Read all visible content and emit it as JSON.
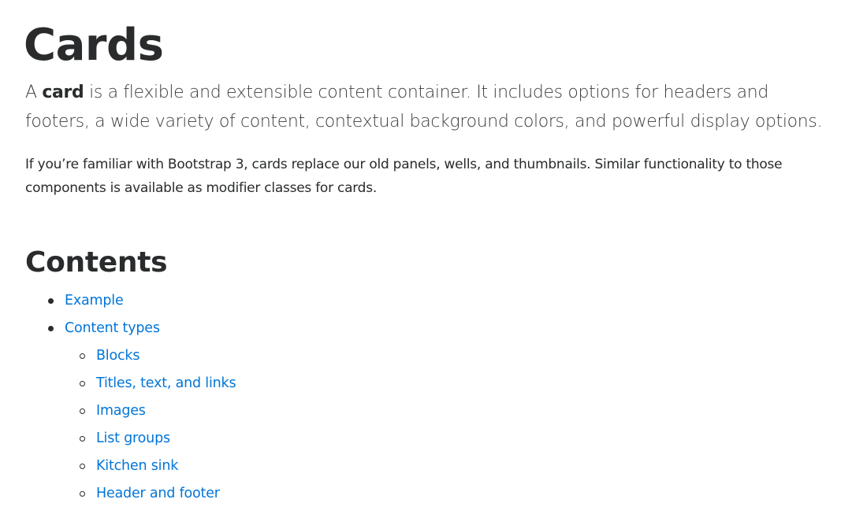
{
  "page": {
    "title": "Cards",
    "lead": {
      "prefix": "A ",
      "bold": "card",
      "suffix": " is a flexible and extensible content container. It includes options for headers and footers, a wide variety of content, contextual background colors, and powerful display options."
    },
    "body": "If you’re familiar with Bootstrap 3, cards replace our old panels, wells, and thumbnails. Similar functionality to those components is available as modifier classes for cards."
  },
  "contents": {
    "title": "Contents",
    "items": [
      {
        "label": "Example",
        "level": 1
      },
      {
        "label": "Content types",
        "level": 1
      },
      {
        "label": "Blocks",
        "level": 2
      },
      {
        "label": "Titles, text, and links",
        "level": 2
      },
      {
        "label": "Images",
        "level": 2
      },
      {
        "label": "List groups",
        "level": 2
      },
      {
        "label": "Kitchen sink",
        "level": 2
      },
      {
        "label": "Header and footer",
        "level": 2
      }
    ]
  },
  "colors": {
    "text": "#292b2c",
    "link": "#0275d8",
    "background": "#ffffff"
  }
}
